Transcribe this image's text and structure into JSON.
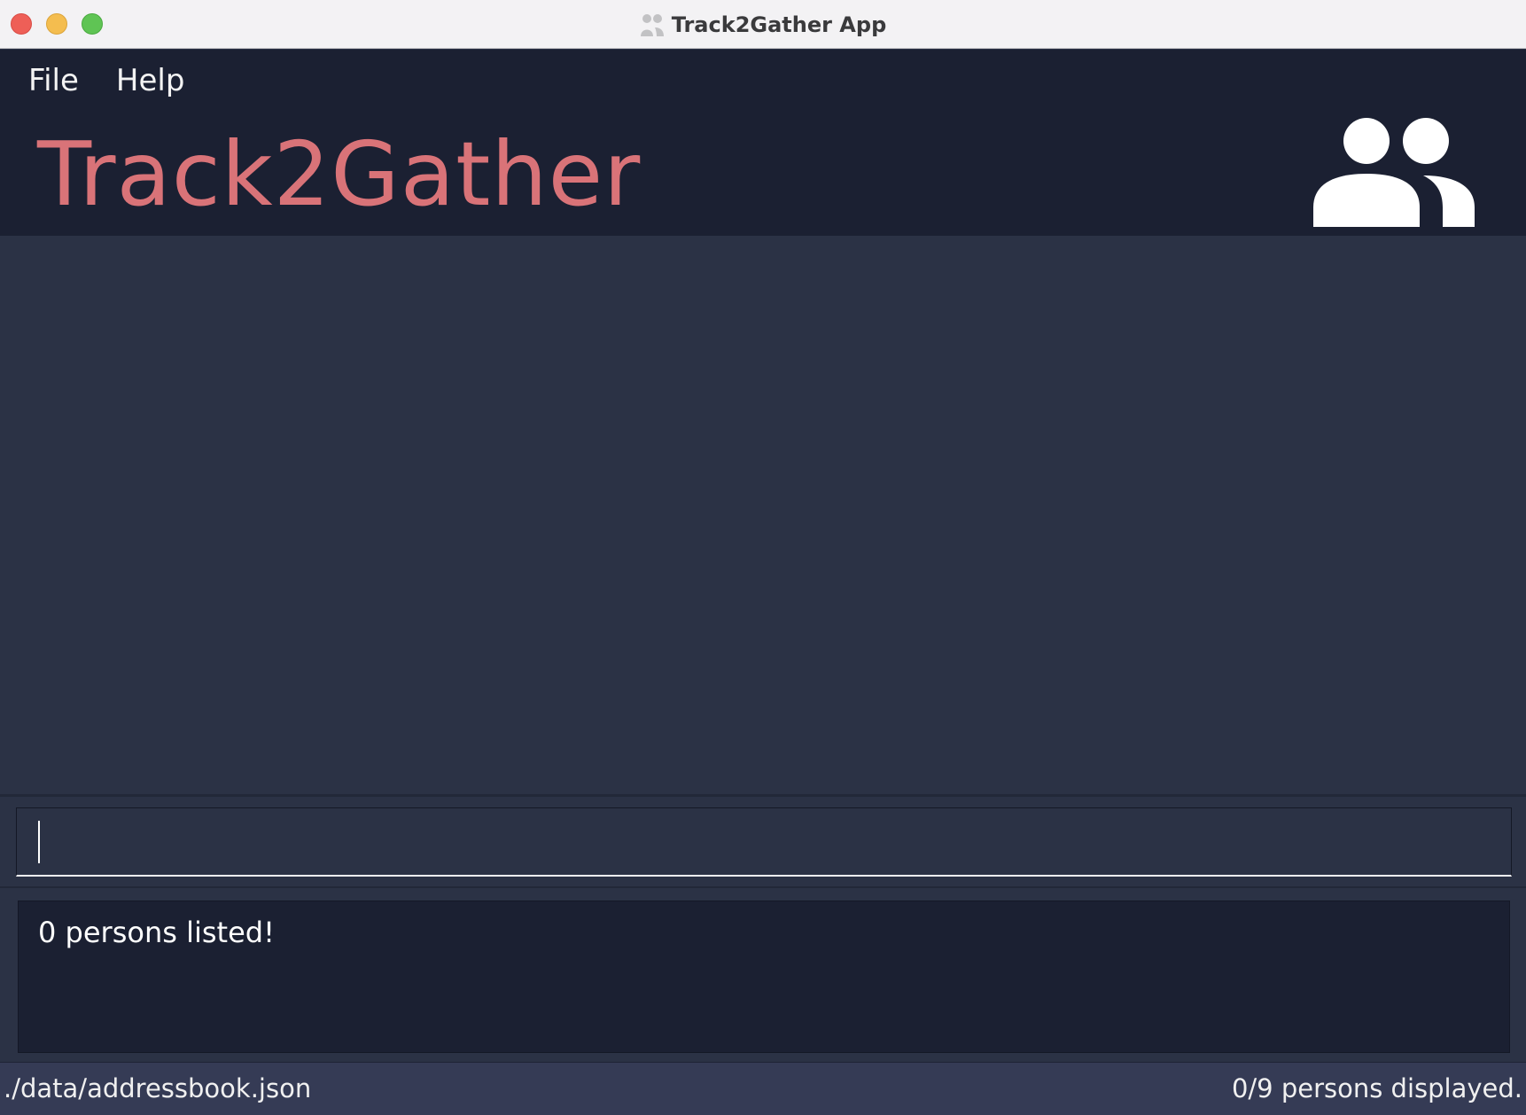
{
  "window": {
    "title": "Track2Gather App"
  },
  "menu": {
    "items": [
      {
        "label": "File"
      },
      {
        "label": "Help"
      }
    ]
  },
  "header": {
    "heading": "Track2Gather",
    "icon": "people-group-icon"
  },
  "command": {
    "value": "",
    "placeholder": ""
  },
  "result": {
    "message": "0 persons listed!"
  },
  "status": {
    "file_path": "./data/addressbook.json",
    "count_text": "0/9 persons displayed."
  },
  "colors": {
    "title_bar": "#f3f2f4",
    "header_bg": "#1b2032",
    "main_bg": "#2b3245",
    "status_bg": "#353b55",
    "heading_accent": "#d97378",
    "traffic_close": "#ee5f57",
    "traffic_minimize": "#f4bd4f",
    "traffic_zoom": "#5fc454"
  }
}
